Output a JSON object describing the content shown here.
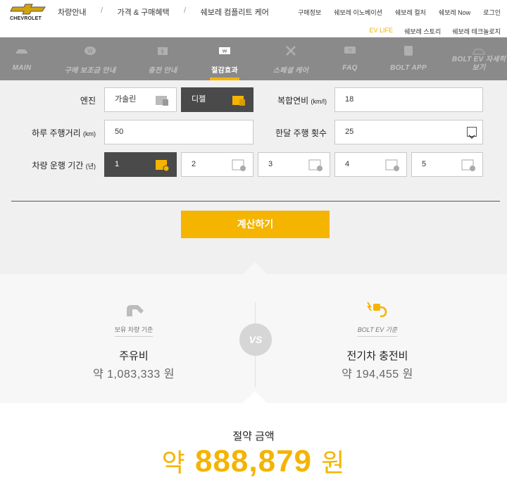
{
  "brand": {
    "name": "CHEVROLET",
    "accent": "#f4b400"
  },
  "main_nav": [
    "차량안내",
    "가격 & 구매혜택",
    "쉐보레 컴플리트 케어"
  ],
  "util_nav": [
    "구매정보",
    "쉐보레 이노베이션",
    "쉐보레 컬처",
    "쉐보레 Now",
    "로그인"
  ],
  "sub_nav": [
    "EV LIFE",
    "쉐보레 스토리",
    "쉐보레 테크놀로지"
  ],
  "tabs": [
    {
      "label": "MAIN",
      "icon": "car-icon"
    },
    {
      "label": "구매 보조금 안내",
      "icon": "coin-icon"
    },
    {
      "label": "충전 안내",
      "icon": "charger-icon"
    },
    {
      "label": "절감효과",
      "icon": "savings-icon"
    },
    {
      "label": "스페셜 케어",
      "icon": "tools-icon"
    },
    {
      "label": "FAQ",
      "icon": "faq-icon"
    },
    {
      "label": "BOLT APP",
      "icon": "app-icon"
    },
    {
      "label": "BOLT EV 자세히 보기",
      "icon": "ev-car-icon"
    }
  ],
  "form": {
    "engine_label": "엔진",
    "engine_options": [
      "가솔린",
      "디젤"
    ],
    "engine_selected": "디젤",
    "fuel_eff_label": "복합연비",
    "fuel_eff_unit": "(km/l)",
    "fuel_eff_value": "18",
    "daily_dist_label": "하루 주행거리",
    "daily_dist_unit": "(km)",
    "daily_dist_value": "50",
    "monthly_count_label": "한달 주행 횟수",
    "monthly_count_value": "25",
    "period_label": "차량 운행 기간",
    "period_unit": "(년)",
    "period_options": [
      "1",
      "2",
      "3",
      "4",
      "5"
    ],
    "period_selected": "1",
    "calc_button": "계산하기"
  },
  "compare": {
    "left_tag": "보유 차량 기준",
    "left_name": "주유비",
    "left_amount": "약 1,083,333 원",
    "vs": "VS",
    "right_tag": "BOLT EV 기준",
    "right_name": "전기차 충전비",
    "right_amount": "약 194,455 원"
  },
  "savings": {
    "title": "절약 금액",
    "prefix": "약",
    "amount": "888,879",
    "suffix": "원"
  }
}
